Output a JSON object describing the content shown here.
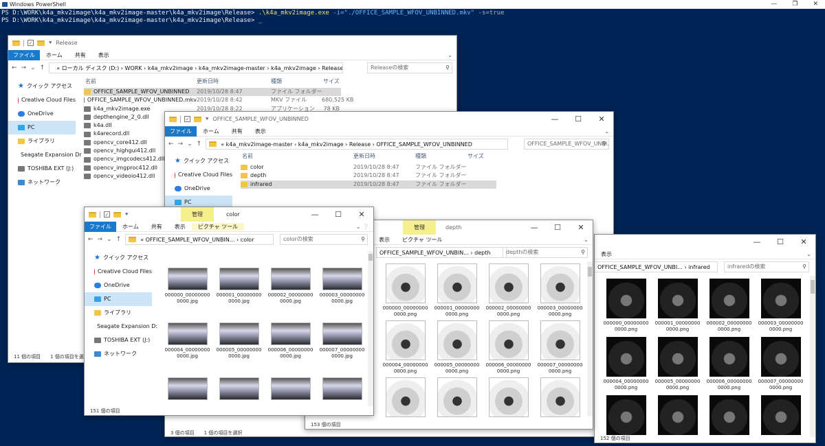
{
  "powershell": {
    "title": "Windows PowerShell",
    "line1_prompt": "PS D:\\WORK\\k4a_mkv2image\\k4a_mkv2image-master\\k4a_mkv2image\\Release>",
    "line1_cmd": ".\\k4a_mkv2image.exe",
    "line1_arg": "-i=\"./OFFICE_SAMPLE_WFOV_UNBINNED.mkv\"",
    "line1_flag": "-s=true",
    "line2_prompt": "PS D:\\WORK\\k4a_mkv2image\\k4a_mkv2image-master\\k4a_mkv2image\\Release>",
    "cursor": "_",
    "buttons": {
      "min": "—",
      "max": "❐",
      "close": "✕"
    }
  },
  "common": {
    "file": "ファイル",
    "home": "ホーム",
    "share": "共有",
    "view": "表示",
    "manage": "管理",
    "picture_tools": "ピクチャ ツール",
    "min": "—",
    "max": "☐",
    "close": "✕",
    "back": "←",
    "fwd": "→",
    "down": "⌄",
    "up": "↑",
    "refresh": "↻",
    "search_icon": "⚲",
    "col_name": "名前",
    "col_date": "更新日時",
    "col_type": "種類",
    "col_size": "サイズ",
    "quick_access": "クイック アクセス",
    "creative_cloud": "Creative Cloud Files",
    "onedrive": "OneDrive",
    "pc": "PC",
    "library": "ライブラリ",
    "seagate": "Seagate Expansion Dr",
    "toshiba": "TOSHIBA EXT (J:)",
    "network": "ネットワーク",
    "seagate_short": "Seagate Expansion D:"
  },
  "release_win": {
    "title": "Release",
    "address": "« ローカル ディスク (D:) › WORK › k4a_mkv2image › k4a_mkv2image-master › k4a_mkv2image › Release",
    "search": "Releaseの検索",
    "files": [
      {
        "name": "OFFICE_SAMPLE_WFOV_UNBINNED",
        "date": "2019/10/28 8:47",
        "type": "ファイル フォルダー",
        "size": ""
      },
      {
        "name": "OFFICE_SAMPLE_WFOV_UNBINNED.mkv",
        "date": "2019/10/28 8:42",
        "type": "MKV ファイル",
        "size": "680,525 KB"
      },
      {
        "name": "k4a_mkv2image.exe",
        "date": "2019/10/28 8:22",
        "type": "アプリケーション",
        "size": "78 KB"
      },
      {
        "name": "depthengine_2_0.dll",
        "date": "",
        "type": "",
        "size": ""
      },
      {
        "name": "k4a.dll",
        "date": "",
        "type": "",
        "size": ""
      },
      {
        "name": "k4arecord.dll",
        "date": "",
        "type": "",
        "size": ""
      },
      {
        "name": "opencv_core412.dll",
        "date": "",
        "type": "",
        "size": ""
      },
      {
        "name": "opencv_highgui412.dll",
        "date": "",
        "type": "",
        "size": ""
      },
      {
        "name": "opencv_imgcodecs412.dll",
        "date": "",
        "type": "",
        "size": ""
      },
      {
        "name": "opencv_imgproc412.dll",
        "date": "",
        "type": "",
        "size": ""
      },
      {
        "name": "opencv_videoio412.dll",
        "date": "",
        "type": "",
        "size": ""
      }
    ],
    "status": "11 個の項目　　1 個の項目を選択"
  },
  "office_win": {
    "title": "OFFICE_SAMPLE_WFOV_UNBINNED",
    "address": "« k4a_mkv2image-master › k4a_mkv2image › Release › OFFICE_SAMPLE_WFOV_UNBINNED",
    "search": "OFFICE_SAMPLE_WFOV_UNBI...",
    "folders": [
      {
        "name": "color",
        "date": "2019/10/28 8:47",
        "type": "ファイル フォルダー"
      },
      {
        "name": "depth",
        "date": "2019/10/28 8:47",
        "type": "ファイル フォルダー"
      },
      {
        "name": "infrared",
        "date": "2019/10/28 8:47",
        "type": "ファイル フォルダー"
      }
    ],
    "status": "3 個の項目　　1 個の項目を選択"
  },
  "color_win": {
    "title": "color",
    "address": "« OFFICE_SAMPLE_WFOV_UNBIN... › color",
    "search": "colorの検索",
    "thumbs": [
      "000000_000000000000.jpg",
      "000001_000000000000.jpg",
      "000002_000000000000.jpg",
      "000003_000000000000.jpg",
      "000004_000000000000.jpg",
      "000005_000000000000.jpg",
      "000006_000000000000.jpg",
      "000007_000000000000.jpg"
    ],
    "thumb_lines": [
      [
        "000000_00000000",
        "0000.jpg"
      ],
      [
        "000001_00000000",
        "0000.jpg"
      ],
      [
        "000002_00000000",
        "0000.jpg"
      ],
      [
        "000003_00000000",
        "0000.jpg"
      ],
      [
        "000004_00000000",
        "0000.jpg"
      ],
      [
        "000005_00000000",
        "0000.jpg"
      ],
      [
        "000006_00000000",
        "0000.jpg"
      ],
      [
        "000007_00000000",
        "0000.jpg"
      ]
    ],
    "status": "151 個の項目"
  },
  "depth_win": {
    "title": "depth",
    "address": "OFFICE_SAMPLE_WFOV_UNBIN... › depth",
    "search": "depthの検索",
    "thumb_lines": [
      [
        "000000_00000000",
        "0000.png"
      ],
      [
        "000001_00000000",
        "0000.png"
      ],
      [
        "000002_00000000",
        "0000.png"
      ],
      [
        "000003_00000000",
        "0000.png"
      ],
      [
        "000004_00000000",
        "0000.png"
      ],
      [
        "000005_00000000",
        "0000.png"
      ],
      [
        "000006_00000000",
        "0000.png"
      ],
      [
        "000007_00000000",
        "0000.png"
      ]
    ],
    "status": "153 個の項目"
  },
  "ir_win": {
    "title": "",
    "address": "OFFICE_SAMPLE_WFOV_UNBI... › infrared",
    "search": "infraredの検索",
    "thumb_lines": [
      [
        "000000_00000000",
        "0000.png"
      ],
      [
        "000001_00000000",
        "0000.png"
      ],
      [
        "000002_00000000",
        "0000.png"
      ],
      [
        "000003_00000000",
        "0000.png"
      ],
      [
        "000004_00000000",
        "0000.png"
      ],
      [
        "000005_00000000",
        "0000.png"
      ],
      [
        "000006_00000000",
        "0000.png"
      ],
      [
        "000007_00000000",
        "0000.png"
      ]
    ],
    "status": "152 個の項目"
  }
}
